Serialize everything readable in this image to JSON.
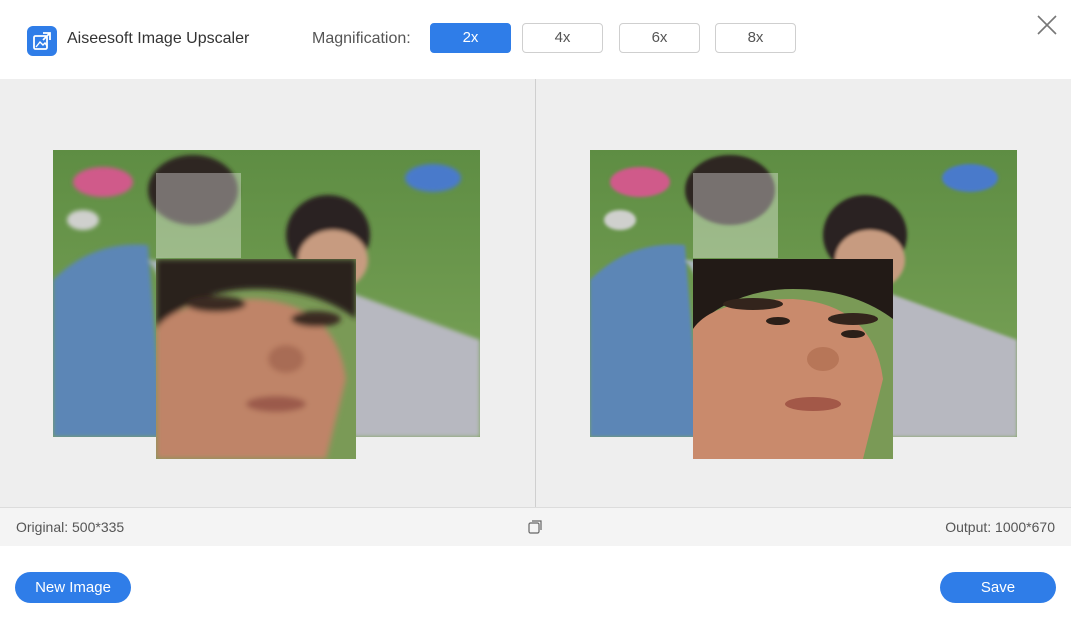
{
  "header": {
    "app_title": "Aiseesoft Image Upscaler",
    "magnification_label": "Magnification:",
    "options": [
      "2x",
      "4x",
      "6x",
      "8x"
    ],
    "selected": "2x"
  },
  "status": {
    "original": "Original: 500*335",
    "output": "Output: 1000*670"
  },
  "footer": {
    "new_image": "New Image",
    "save": "Save"
  },
  "colors": {
    "accent": "#2f7de8",
    "preview_bg": "#eeeeee",
    "status_bg": "#f4f4f4"
  },
  "icons": [
    "app-logo-icon",
    "close-icon",
    "compare-icon"
  ]
}
